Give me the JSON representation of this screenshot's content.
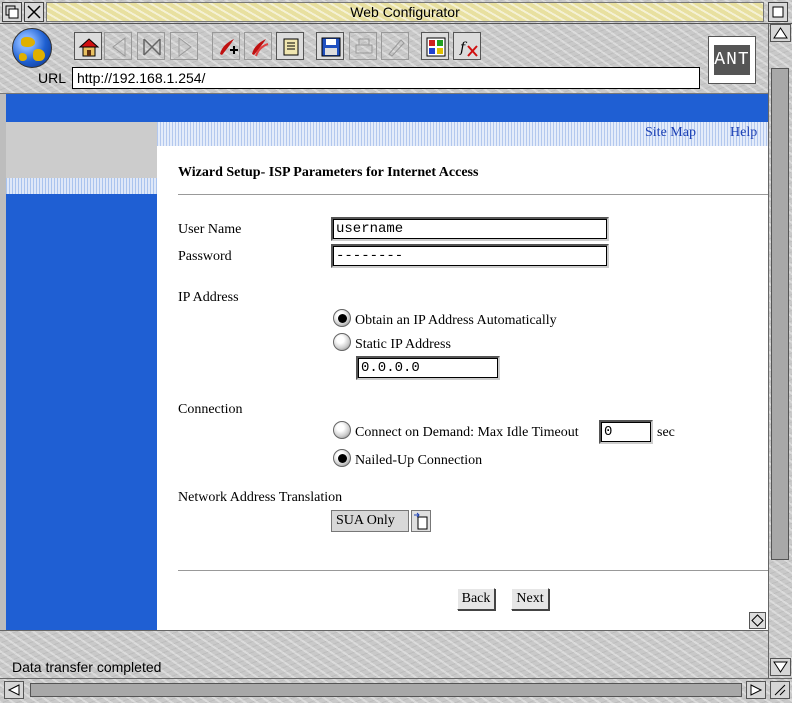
{
  "window": {
    "title": "Web Configurator"
  },
  "toolbar": {
    "url_label": "URL",
    "url_value": "http://192.168.1.254/",
    "logo_text": "ANT"
  },
  "nav": {
    "site_map": "Site Map",
    "help": "Help"
  },
  "page": {
    "title": "Wizard Setup- ISP Parameters for Internet Access"
  },
  "form": {
    "user_name_label": "User Name",
    "user_name_value": "username",
    "password_label": "Password",
    "password_value": "--------",
    "ip_address_label": "IP Address",
    "ip_auto_label": "Obtain an IP Address Automatically",
    "ip_static_label": "Static IP Address",
    "ip_static_value": "0.0.0.0",
    "connection_label": "Connection",
    "connect_on_demand_label": "Connect on Demand: Max Idle Timeout",
    "idle_timeout_value": "0",
    "idle_timeout_unit": "sec",
    "nailed_up_label": "Nailed-Up Connection",
    "nat_label": "Network Address Translation",
    "nat_selected": "SUA Only"
  },
  "buttons": {
    "back": "Back",
    "next": "Next"
  },
  "status": {
    "text": "Data transfer completed"
  },
  "colors": {
    "sidebar_blue": "#1f5fd3",
    "link_blue": "#1a3fb5",
    "title_strip": "#e8e0a0"
  }
}
